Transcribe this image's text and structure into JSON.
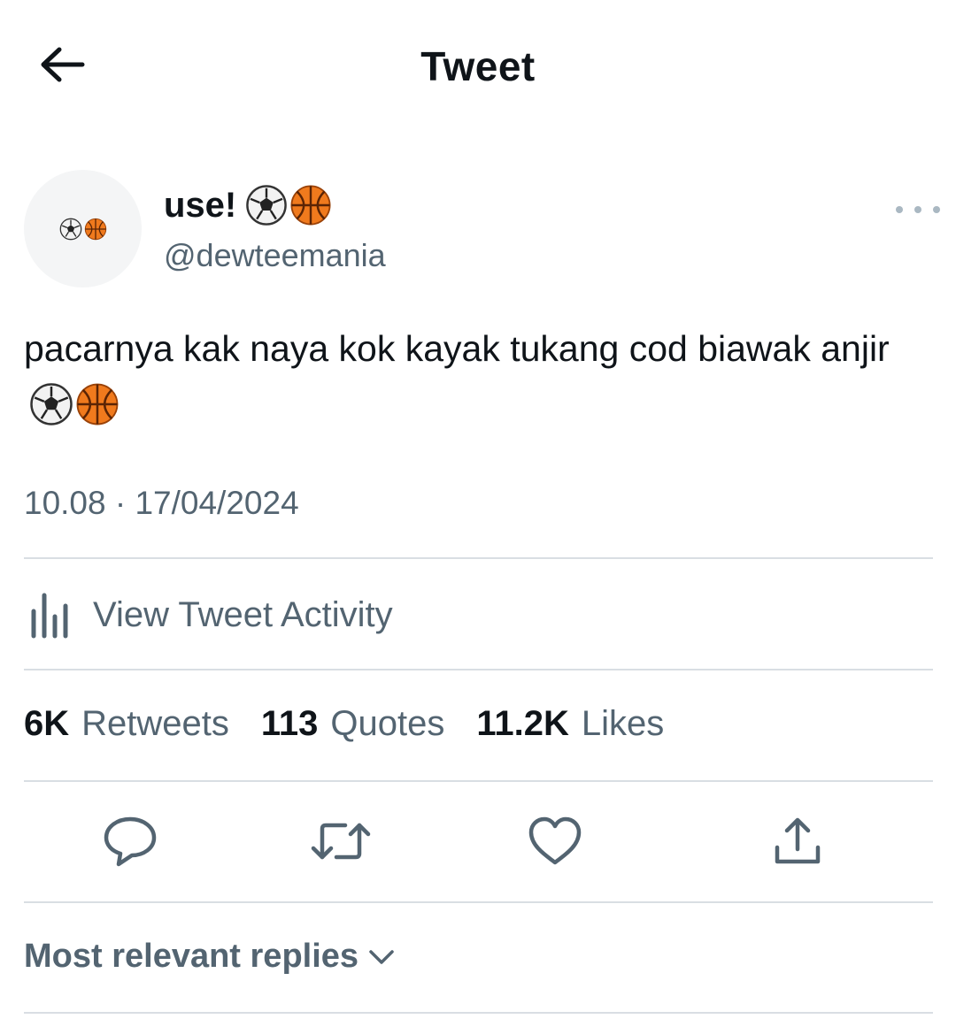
{
  "header": {
    "title": "Tweet",
    "back_icon": "arrow-left-icon"
  },
  "author": {
    "display_name": "use!",
    "name_emoji": [
      "⚽",
      "🏀"
    ],
    "handle": "@dewteemania",
    "avatar_emoji": [
      "⚽",
      "🏀"
    ]
  },
  "tweet": {
    "text": "pacarnya kak naya kok kayak tukang cod biawak anjir",
    "text_emoji": [
      "⚽",
      "🏀"
    ],
    "timestamp": "10.08 · 17/04/2024"
  },
  "activity": {
    "label": "View Tweet Activity",
    "icon": "bar-chart-icon"
  },
  "stats": [
    {
      "count": "6K",
      "label": "Retweets"
    },
    {
      "count": "113",
      "label": "Quotes"
    },
    {
      "count": "11.2K",
      "label": "Likes"
    }
  ],
  "actions": [
    "reply-icon",
    "retweet-icon",
    "like-icon",
    "share-icon"
  ],
  "replies": {
    "label": "Most relevant replies"
  },
  "colors": {
    "text": "#0f1419",
    "secondary": "#536471",
    "divider": "#d9dee3"
  }
}
